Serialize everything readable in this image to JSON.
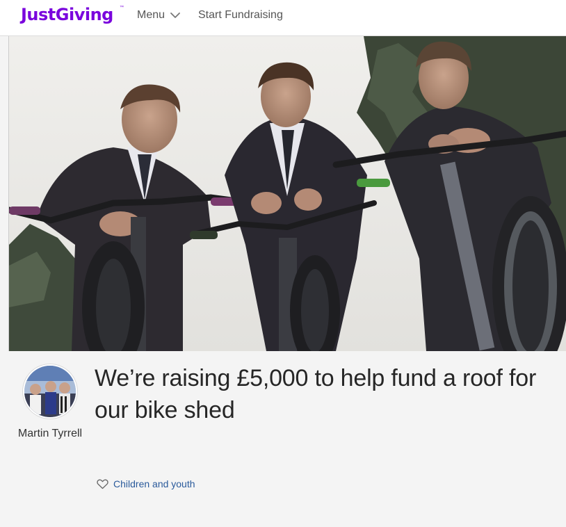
{
  "header": {
    "logo_text": "JustGiving",
    "logo_tm": "™",
    "menu_label": "Menu",
    "start_fundraising_label": "Start Fundraising",
    "brand_color": "#7a04dd"
  },
  "hero": {
    "image_alt": "Three boys in school blazers with mountain bikes"
  },
  "fundraiser": {
    "title": "We’re raising £5,000 to help fund a roof for our bike shed",
    "owner_name": "Martin Tyrrell",
    "category": "Children and youth"
  },
  "icons": {
    "menu": "chevron-down-icon",
    "category": "heart-icon"
  }
}
